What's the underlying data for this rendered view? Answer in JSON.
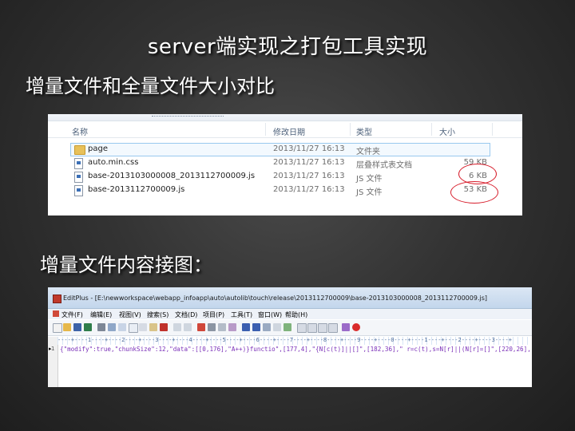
{
  "slide": {
    "title": "server端实现之打包工具实现",
    "subtitle": "增量文件和全量文件大小对比",
    "subtitle2": "增量文件内容接图："
  },
  "explorer": {
    "columns": [
      "名称",
      "修改日期",
      "类型",
      "大小"
    ],
    "rows": [
      {
        "name": "page",
        "date": "2013/11/27 16:13",
        "type": "文件夹",
        "size": "",
        "icon": "folder-icon",
        "selected": true
      },
      {
        "name": "auto.min.css",
        "date": "2013/11/27 16:13",
        "type": "层叠样式表文档",
        "size": "59 KB",
        "icon": "css-file-icon",
        "selected": false
      },
      {
        "name": "base-2013103000008_2013112700009.js",
        "date": "2013/11/27 16:13",
        "type": "JS 文件",
        "size": "6 KB",
        "icon": "js-file-icon",
        "selected": false,
        "circled": true
      },
      {
        "name": "base-2013112700009.js",
        "date": "2013/11/27 16:13",
        "type": "JS 文件",
        "size": "53 KB",
        "icon": "js-file-icon",
        "selected": false,
        "circled": true
      }
    ],
    "ring_color": "#d71d2b"
  },
  "editplus": {
    "title": "EditPlus - [E:\\newworkspace\\webapp_infoapp\\auto\\autolib\\touch\\release\\2013112700009\\base-2013103000008_2013112700009.js]",
    "menu": [
      "文件(F)",
      "编辑(E)",
      "视图(V)",
      "搜索(S)",
      "文档(D)",
      "项目(P)",
      "工具(T)",
      "窗口(W)",
      "帮助(H)"
    ],
    "ruler": "----+----1----+----2----+----3----+----4----+----5----+----6----+----7----+----8----+----9----+----0----+----1----+----2----+----3----+",
    "line_number": "1",
    "caret_marker": "▸",
    "code": "{\"modify\":true,\"chunkSize\":12,\"data\":[[0,176],\"A++)}functio\",[177,4],\"{N[c(t)]||[]\",[182,36],\" r=c(t),s=N[r]||(N[r]=[]\",[220,26],\"){de"
  }
}
